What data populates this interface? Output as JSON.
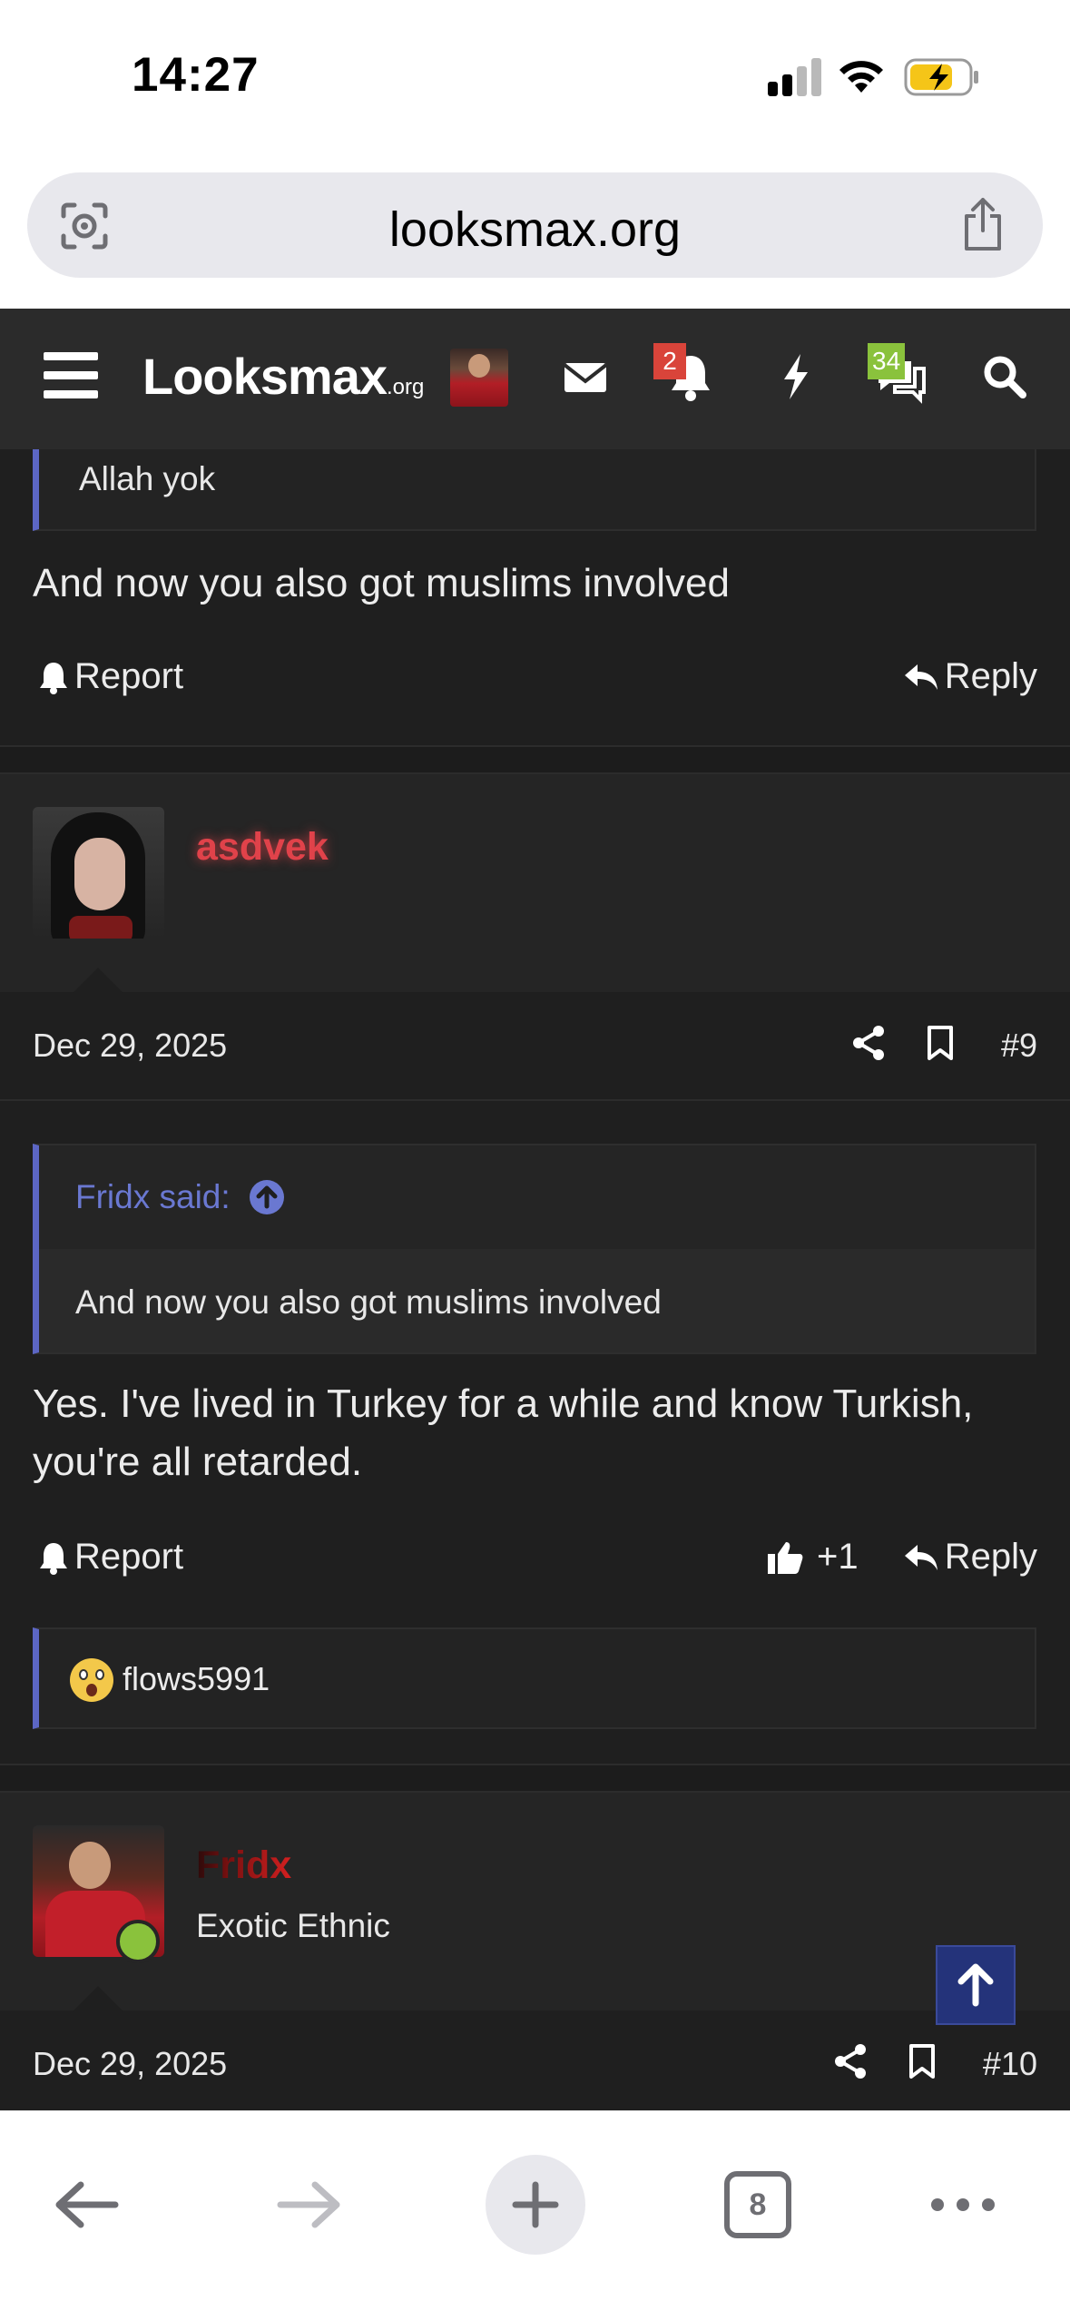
{
  "status": {
    "time": "14:27"
  },
  "browser": {
    "url": "looksmax.org",
    "tab_count": "8"
  },
  "site_header": {
    "logo_main": "Looksmax",
    "logo_suffix": ".org",
    "alerts_badge": "2",
    "conversations_badge": "34"
  },
  "posts": [
    {
      "quote_text": "Allah yok",
      "body": "And now you also got muslims involved",
      "report_label": "Report",
      "reply_label": "Reply"
    },
    {
      "username": "asdvek",
      "date": "Dec 29, 2025",
      "number": "#9",
      "quote_author": "Fridx said:",
      "quote_text": "And now you also got muslims involved",
      "body_line1": "Yes. I've lived in Turkey for a while and know Turkish,",
      "body_line2": "you're all retarded.",
      "report_label": "Report",
      "like_count": "+1",
      "reply_label": "Reply",
      "reaction_user": "flows5991"
    },
    {
      "username": "Fridx",
      "user_title": "Exotic Ethnic",
      "date": "Dec 29, 2025",
      "number": "#10"
    }
  ],
  "colors": {
    "header_bg": "#2b2b2b",
    "content_bg": "#1f1f1f",
    "quote_accent": "#5c66c4",
    "username_asdvek": "#e0424a",
    "username_fridx": "#c81e1e",
    "online_dot": "#8ac23c",
    "scroll_top_bg": "#24337a"
  }
}
